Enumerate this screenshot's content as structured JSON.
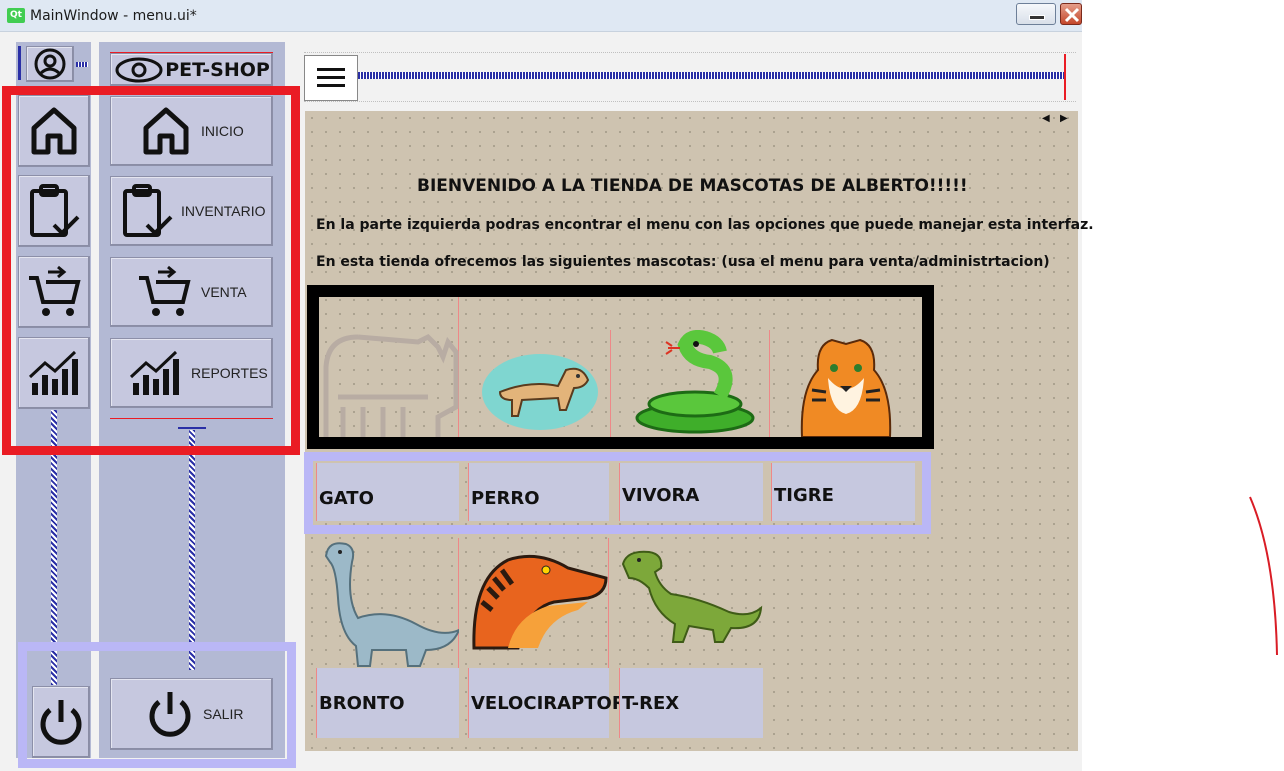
{
  "window": {
    "badge": "Qt",
    "title": "MainWindow - menu.ui*"
  },
  "sidebar": {
    "brand": "PET-SHOP",
    "items": [
      {
        "label": "INICIO",
        "icon": "home-icon"
      },
      {
        "label": "INVENTARIO",
        "icon": "clipboard-check-icon"
      },
      {
        "label": "VENTA",
        "icon": "cart-icon"
      },
      {
        "label": "REPORTES",
        "icon": "chart-icon"
      }
    ],
    "exit_label": "SALIR"
  },
  "main": {
    "welcome": "BIENVENIDO A LA TIENDA DE MASCOTAS DE ALBERTO!!!!!",
    "info1": "En la parte izquierda podras encontrar el menu con las opciones que puede manejar esta interfaz.",
    "info2": "En esta tienda ofrecemos las siguientes mascotas: (usa el menu para venta/administrtacion)",
    "pets_row1": [
      "GATO",
      "PERRO",
      "VIVORA",
      "TIGRE"
    ],
    "pets_row2": [
      "BRONTO",
      "VELOCIRAPTOR",
      "T-REX"
    ]
  },
  "colors": {
    "sidebar_bg": "#b3b9d4",
    "button_bg": "#c6c8df",
    "content_bg": "#cec3b0",
    "annotation_red": "#ea1c24",
    "annotation_lavender": "#bab7f6"
  }
}
